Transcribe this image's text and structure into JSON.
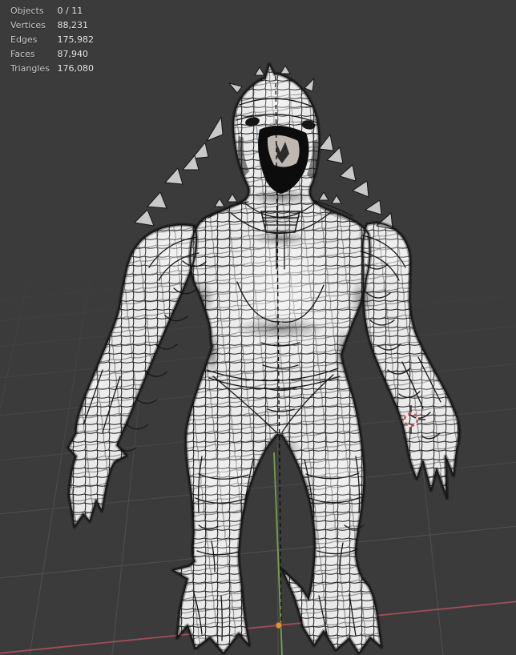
{
  "viewport": {
    "background_color": "#3b3b3b",
    "grid_color": "#4a4a4a",
    "x_axis_color": "#a24e58",
    "y_axis_color": "#76a14e",
    "origin_color": "#e2913f",
    "cursor_ring_red": "#cc4f4f"
  },
  "stats_overlay": {
    "rows": [
      {
        "label": "Objects",
        "value": "0 / 11"
      },
      {
        "label": "Vertices",
        "value": "88,231"
      },
      {
        "label": "Edges",
        "value": "175,982"
      },
      {
        "label": "Faces",
        "value": "87,940"
      },
      {
        "label": "Triangles",
        "value": "176,080"
      }
    ]
  }
}
